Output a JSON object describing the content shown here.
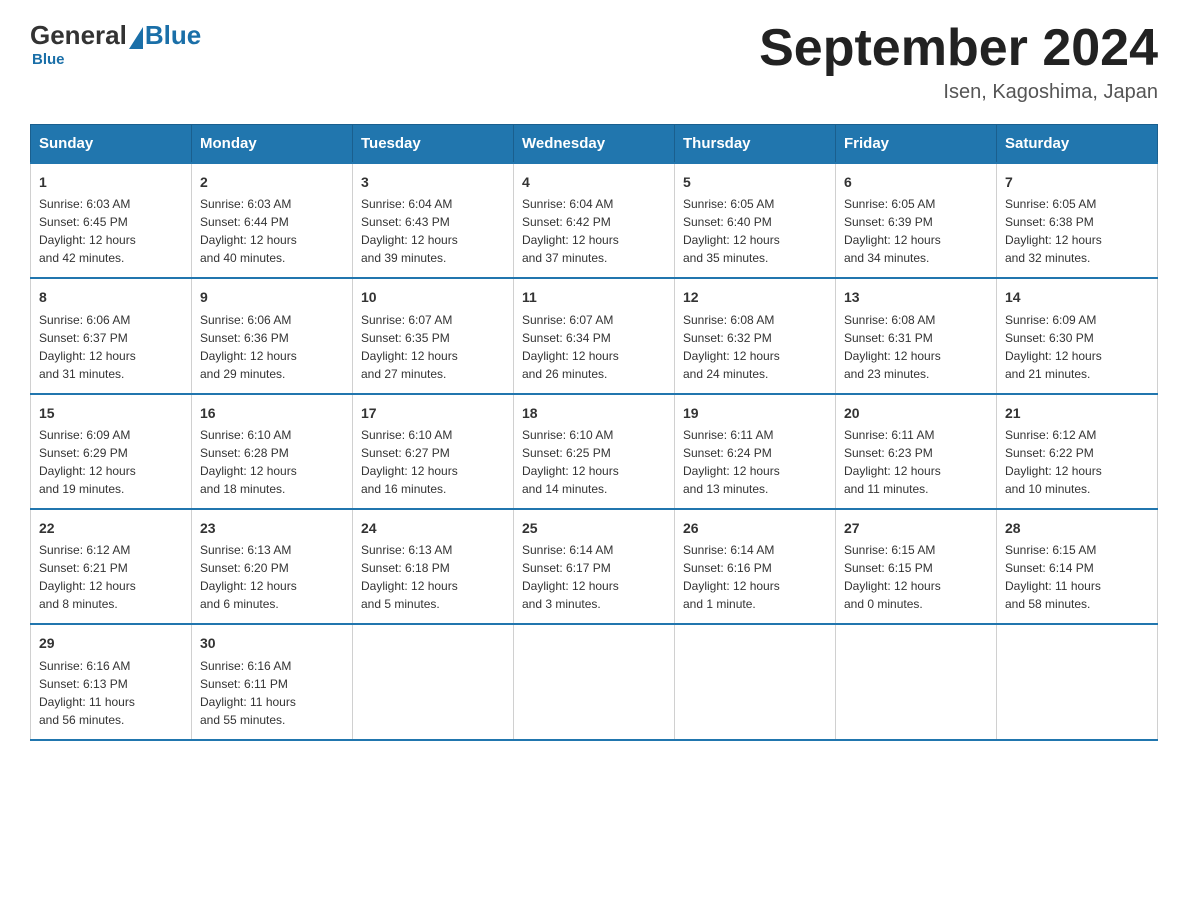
{
  "logo": {
    "general": "General",
    "blue": "Blue",
    "subtitle": "Blue"
  },
  "title": "September 2024",
  "location": "Isen, Kagoshima, Japan",
  "headers": [
    "Sunday",
    "Monday",
    "Tuesday",
    "Wednesday",
    "Thursday",
    "Friday",
    "Saturday"
  ],
  "weeks": [
    [
      {
        "day": "1",
        "sunrise": "6:03 AM",
        "sunset": "6:45 PM",
        "daylight": "12 hours and 42 minutes."
      },
      {
        "day": "2",
        "sunrise": "6:03 AM",
        "sunset": "6:44 PM",
        "daylight": "12 hours and 40 minutes."
      },
      {
        "day": "3",
        "sunrise": "6:04 AM",
        "sunset": "6:43 PM",
        "daylight": "12 hours and 39 minutes."
      },
      {
        "day": "4",
        "sunrise": "6:04 AM",
        "sunset": "6:42 PM",
        "daylight": "12 hours and 37 minutes."
      },
      {
        "day": "5",
        "sunrise": "6:05 AM",
        "sunset": "6:40 PM",
        "daylight": "12 hours and 35 minutes."
      },
      {
        "day": "6",
        "sunrise": "6:05 AM",
        "sunset": "6:39 PM",
        "daylight": "12 hours and 34 minutes."
      },
      {
        "day": "7",
        "sunrise": "6:05 AM",
        "sunset": "6:38 PM",
        "daylight": "12 hours and 32 minutes."
      }
    ],
    [
      {
        "day": "8",
        "sunrise": "6:06 AM",
        "sunset": "6:37 PM",
        "daylight": "12 hours and 31 minutes."
      },
      {
        "day": "9",
        "sunrise": "6:06 AM",
        "sunset": "6:36 PM",
        "daylight": "12 hours and 29 minutes."
      },
      {
        "day": "10",
        "sunrise": "6:07 AM",
        "sunset": "6:35 PM",
        "daylight": "12 hours and 27 minutes."
      },
      {
        "day": "11",
        "sunrise": "6:07 AM",
        "sunset": "6:34 PM",
        "daylight": "12 hours and 26 minutes."
      },
      {
        "day": "12",
        "sunrise": "6:08 AM",
        "sunset": "6:32 PM",
        "daylight": "12 hours and 24 minutes."
      },
      {
        "day": "13",
        "sunrise": "6:08 AM",
        "sunset": "6:31 PM",
        "daylight": "12 hours and 23 minutes."
      },
      {
        "day": "14",
        "sunrise": "6:09 AM",
        "sunset": "6:30 PM",
        "daylight": "12 hours and 21 minutes."
      }
    ],
    [
      {
        "day": "15",
        "sunrise": "6:09 AM",
        "sunset": "6:29 PM",
        "daylight": "12 hours and 19 minutes."
      },
      {
        "day": "16",
        "sunrise": "6:10 AM",
        "sunset": "6:28 PM",
        "daylight": "12 hours and 18 minutes."
      },
      {
        "day": "17",
        "sunrise": "6:10 AM",
        "sunset": "6:27 PM",
        "daylight": "12 hours and 16 minutes."
      },
      {
        "day": "18",
        "sunrise": "6:10 AM",
        "sunset": "6:25 PM",
        "daylight": "12 hours and 14 minutes."
      },
      {
        "day": "19",
        "sunrise": "6:11 AM",
        "sunset": "6:24 PM",
        "daylight": "12 hours and 13 minutes."
      },
      {
        "day": "20",
        "sunrise": "6:11 AM",
        "sunset": "6:23 PM",
        "daylight": "12 hours and 11 minutes."
      },
      {
        "day": "21",
        "sunrise": "6:12 AM",
        "sunset": "6:22 PM",
        "daylight": "12 hours and 10 minutes."
      }
    ],
    [
      {
        "day": "22",
        "sunrise": "6:12 AM",
        "sunset": "6:21 PM",
        "daylight": "12 hours and 8 minutes."
      },
      {
        "day": "23",
        "sunrise": "6:13 AM",
        "sunset": "6:20 PM",
        "daylight": "12 hours and 6 minutes."
      },
      {
        "day": "24",
        "sunrise": "6:13 AM",
        "sunset": "6:18 PM",
        "daylight": "12 hours and 5 minutes."
      },
      {
        "day": "25",
        "sunrise": "6:14 AM",
        "sunset": "6:17 PM",
        "daylight": "12 hours and 3 minutes."
      },
      {
        "day": "26",
        "sunrise": "6:14 AM",
        "sunset": "6:16 PM",
        "daylight": "12 hours and 1 minute."
      },
      {
        "day": "27",
        "sunrise": "6:15 AM",
        "sunset": "6:15 PM",
        "daylight": "12 hours and 0 minutes."
      },
      {
        "day": "28",
        "sunrise": "6:15 AM",
        "sunset": "6:14 PM",
        "daylight": "11 hours and 58 minutes."
      }
    ],
    [
      {
        "day": "29",
        "sunrise": "6:16 AM",
        "sunset": "6:13 PM",
        "daylight": "11 hours and 56 minutes."
      },
      {
        "day": "30",
        "sunrise": "6:16 AM",
        "sunset": "6:11 PM",
        "daylight": "11 hours and 55 minutes."
      },
      null,
      null,
      null,
      null,
      null
    ]
  ],
  "labels": {
    "sunrise": "Sunrise:",
    "sunset": "Sunset:",
    "daylight": "Daylight:"
  }
}
